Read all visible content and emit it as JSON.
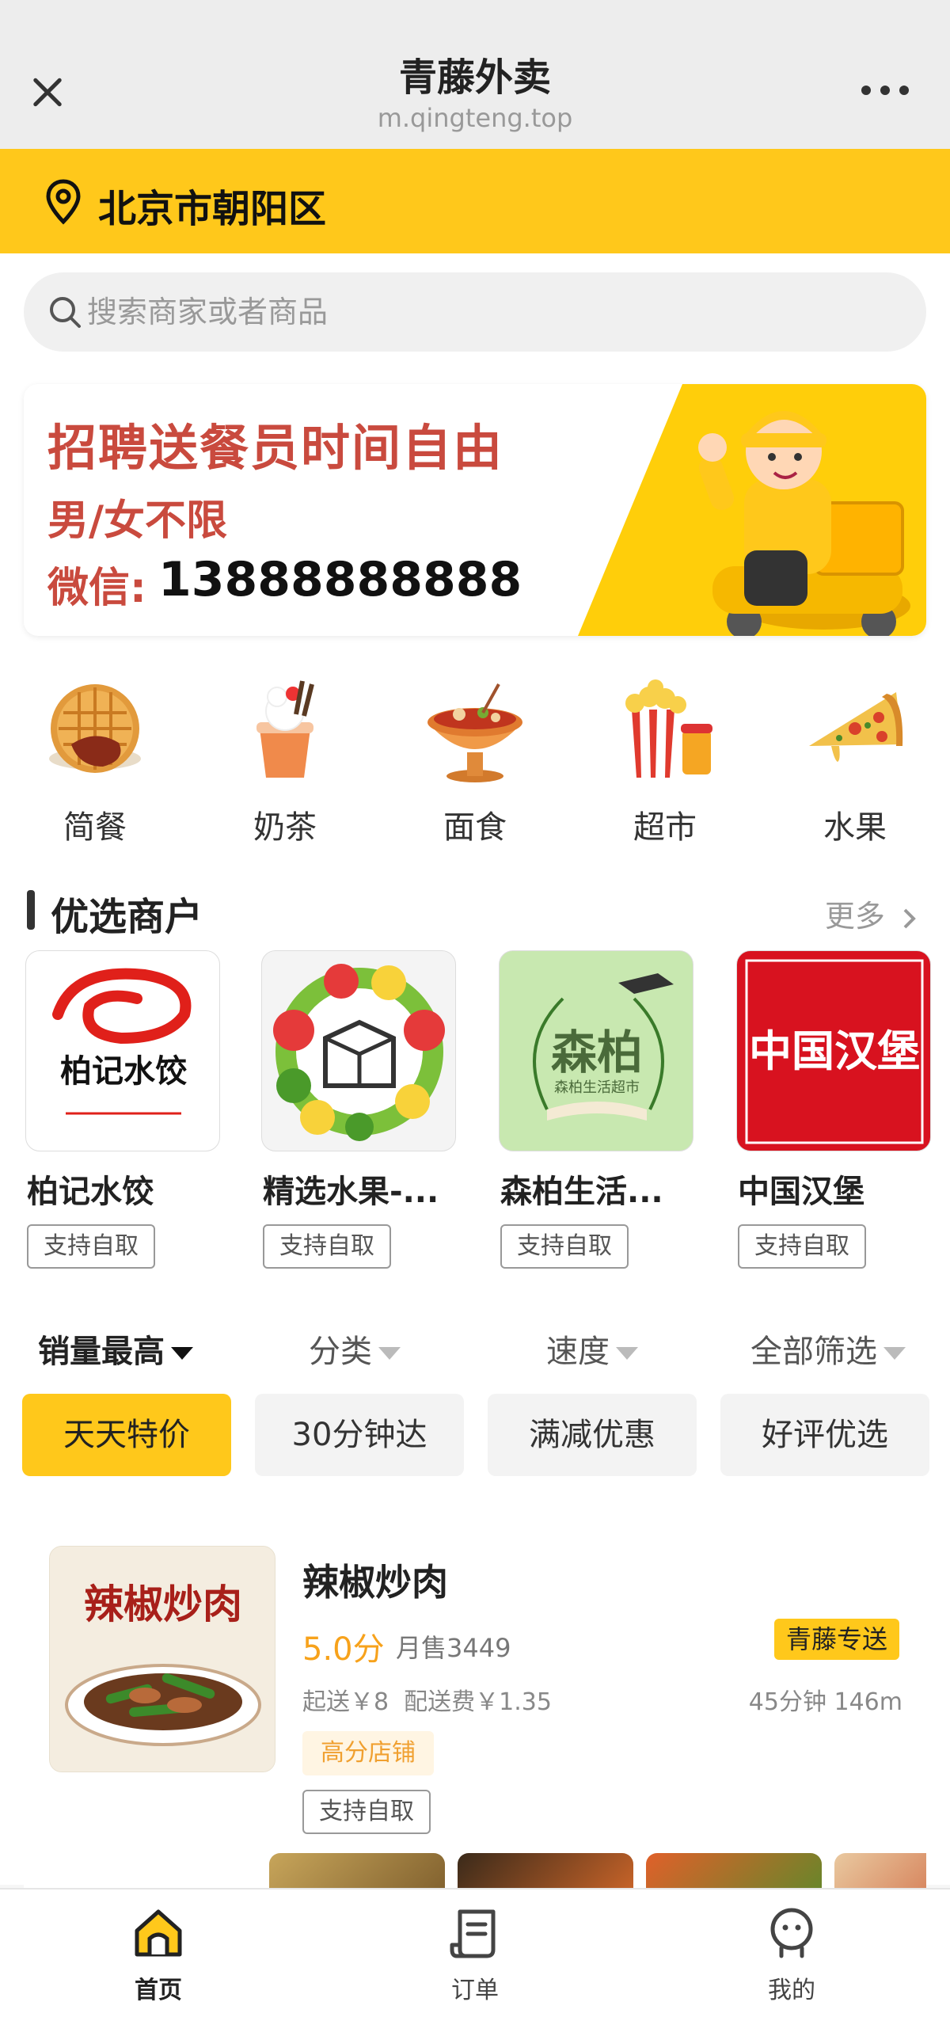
{
  "titlebar": {
    "title": "青藤外卖",
    "url": "m.qingteng.top",
    "close_icon": "close-icon",
    "more_icon": "more-icon"
  },
  "location": {
    "text": "北京市朝阳区",
    "icon": "location-pin-icon"
  },
  "search": {
    "placeholder": "搜索商家或者商品"
  },
  "banner": {
    "line1": "招聘送餐员时间自由",
    "line2": "男/女不限",
    "wechat_label": "微信:",
    "phone": "13888888888"
  },
  "categories": [
    {
      "label": "简餐",
      "icon": "waffle-icon"
    },
    {
      "label": "奶茶",
      "icon": "milk-tea-icon"
    },
    {
      "label": "面食",
      "icon": "hotpot-icon"
    },
    {
      "label": "超市",
      "icon": "popcorn-icon"
    },
    {
      "label": "水果",
      "icon": "pizza-icon"
    }
  ],
  "featured": {
    "title": "优选商户",
    "more": "更多",
    "merchants": [
      {
        "name": "柏记水饺",
        "tag": "支持自取",
        "logo_text": "柏记水饺"
      },
      {
        "name": "精选水果-...",
        "tag": "支持自取",
        "logo_text": ""
      },
      {
        "name": "森柏生活...",
        "tag": "支持自取",
        "logo_text": "森柏",
        "logo_sub": "森柏生活超市"
      },
      {
        "name": "中国汉堡",
        "tag": "支持自取",
        "logo_text": "中国汉堡"
      }
    ]
  },
  "sort": [
    {
      "label": "销量最高",
      "active": true
    },
    {
      "label": "分类",
      "active": false
    },
    {
      "label": "速度",
      "active": false
    },
    {
      "label": "全部筛选",
      "active": false
    }
  ],
  "chips": [
    {
      "label": "天天特价",
      "active": true
    },
    {
      "label": "30分钟达",
      "active": false
    },
    {
      "label": "满减优惠",
      "active": false
    },
    {
      "label": "好评优选",
      "active": false
    }
  ],
  "store": {
    "name": "辣椒炒肉",
    "image_text": "辣椒炒肉",
    "score": "5.0分",
    "monthly_sales": "月售3449",
    "badge": "青藤专送",
    "min_order": "起送￥8",
    "delivery_fee": "配送费￥1.35",
    "time_distance": "45分钟  146m",
    "high_score_tag": "高分店铺",
    "pickup_tag": "支持自取"
  },
  "bottom_nav": [
    {
      "label": "首页",
      "icon": "home-icon",
      "active": true
    },
    {
      "label": "订单",
      "icon": "order-list-icon",
      "active": false
    },
    {
      "label": "我的",
      "icon": "profile-icon",
      "active": false
    }
  ],
  "colors": {
    "accent": "#ffc81b",
    "banner_text": "#c94a3e",
    "score": "#f7a21b"
  }
}
